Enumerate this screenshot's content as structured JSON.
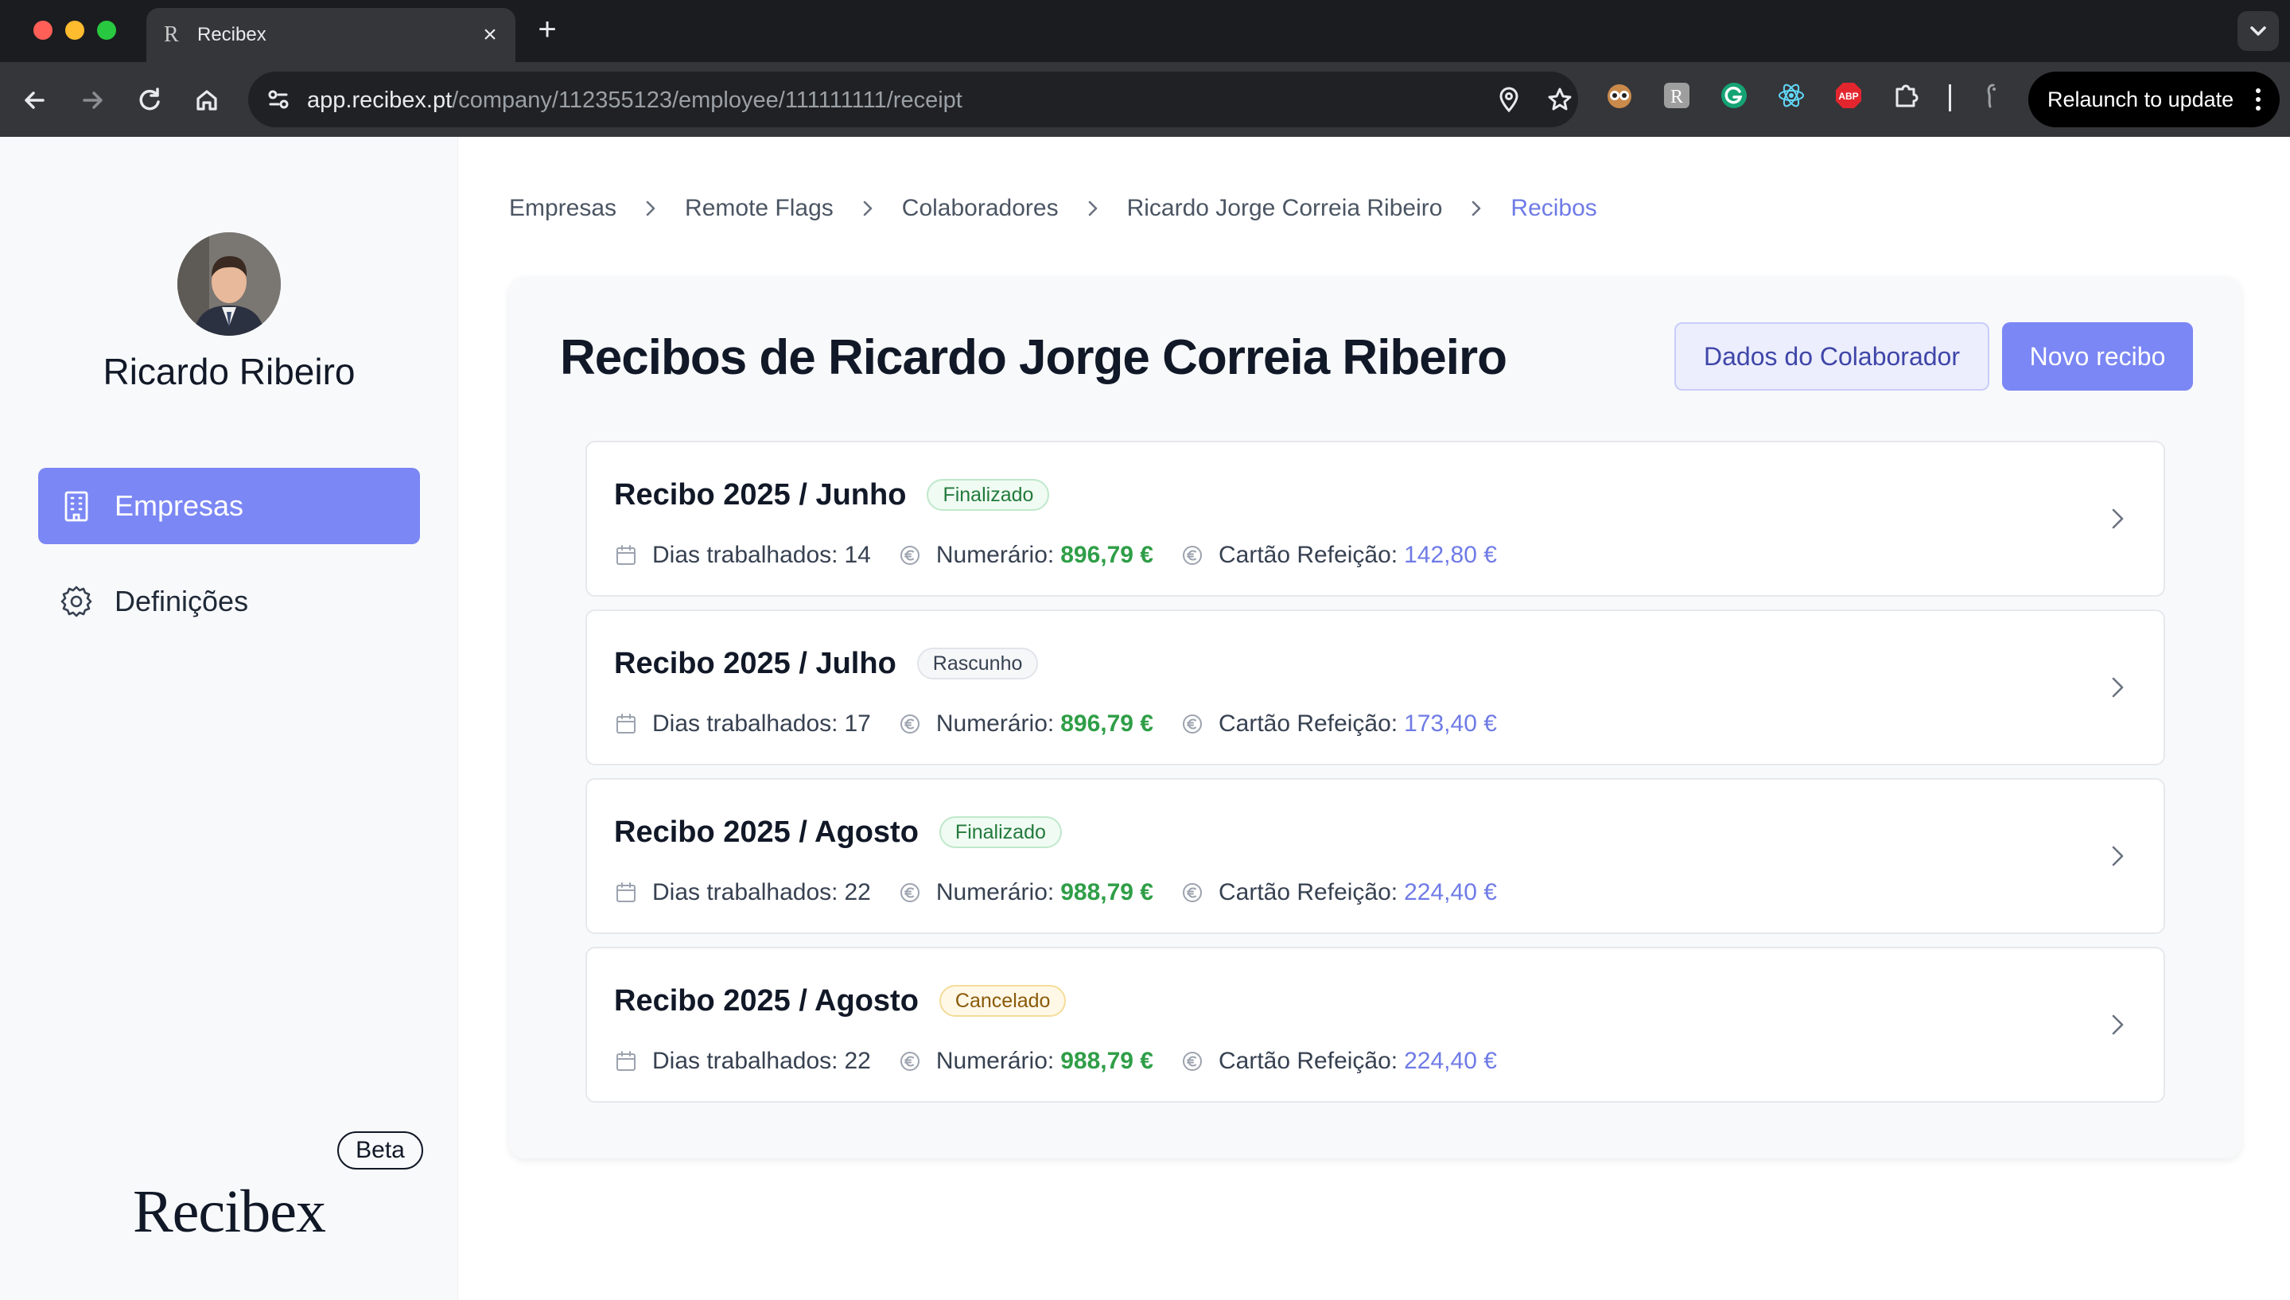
{
  "browser": {
    "tab_title": "Recibex",
    "tab_favicon": "R",
    "url_host": "app.recibex.pt",
    "url_path": "/company/112355123/employee/111111111/receipt",
    "relaunch_label": "Relaunch to update",
    "extension_icons": [
      "owl-extension-icon",
      "r-extension-icon",
      "grammarly-icon",
      "react-devtools-icon",
      "adblock-plus-icon",
      "puzzle-icon",
      "profile-icon"
    ],
    "adblock_text": "ABP"
  },
  "sidebar": {
    "user_name": "Ricardo Ribeiro",
    "items": [
      {
        "label": "Empresas",
        "icon": "building-icon",
        "active": true
      },
      {
        "label": "Definições",
        "icon": "gear-icon",
        "active": false
      }
    ],
    "beta_label": "Beta",
    "logo_text": "Recibex"
  },
  "breadcrumb": [
    "Empresas",
    "Remote Flags",
    "Colaboradores",
    "Ricardo Jorge Correia Ribeiro",
    "Recibos"
  ],
  "page": {
    "title": "Recibos de Ricardo Jorge Correia Ribeiro",
    "secondary_button": "Dados do Colaborador",
    "primary_button": "Novo recibo"
  },
  "labels": {
    "days": "Dias trabalhados:",
    "cash": "Numerário:",
    "meal_card": "Cartão Refeição:"
  },
  "receipts": [
    {
      "title": "Recibo 2025 / Junho",
      "status": "Finalizado",
      "days": "14",
      "cash": "896,79 €",
      "meal_card": "142,80 €"
    },
    {
      "title": "Recibo 2025 / Julho",
      "status": "Rascunho",
      "days": "17",
      "cash": "896,79 €",
      "meal_card": "173,40 €"
    },
    {
      "title": "Recibo 2025 / Agosto",
      "status": "Finalizado",
      "days": "22",
      "cash": "988,79 €",
      "meal_card": "224,40 €"
    },
    {
      "title": "Recibo 2025 / Agosto",
      "status": "Cancelado",
      "days": "22",
      "cash": "988,79 €",
      "meal_card": "224,40 €"
    }
  ],
  "colors": {
    "accent": "#7b87f4",
    "accent_text": "#6f7be6",
    "cash_green": "#2f9e47"
  }
}
